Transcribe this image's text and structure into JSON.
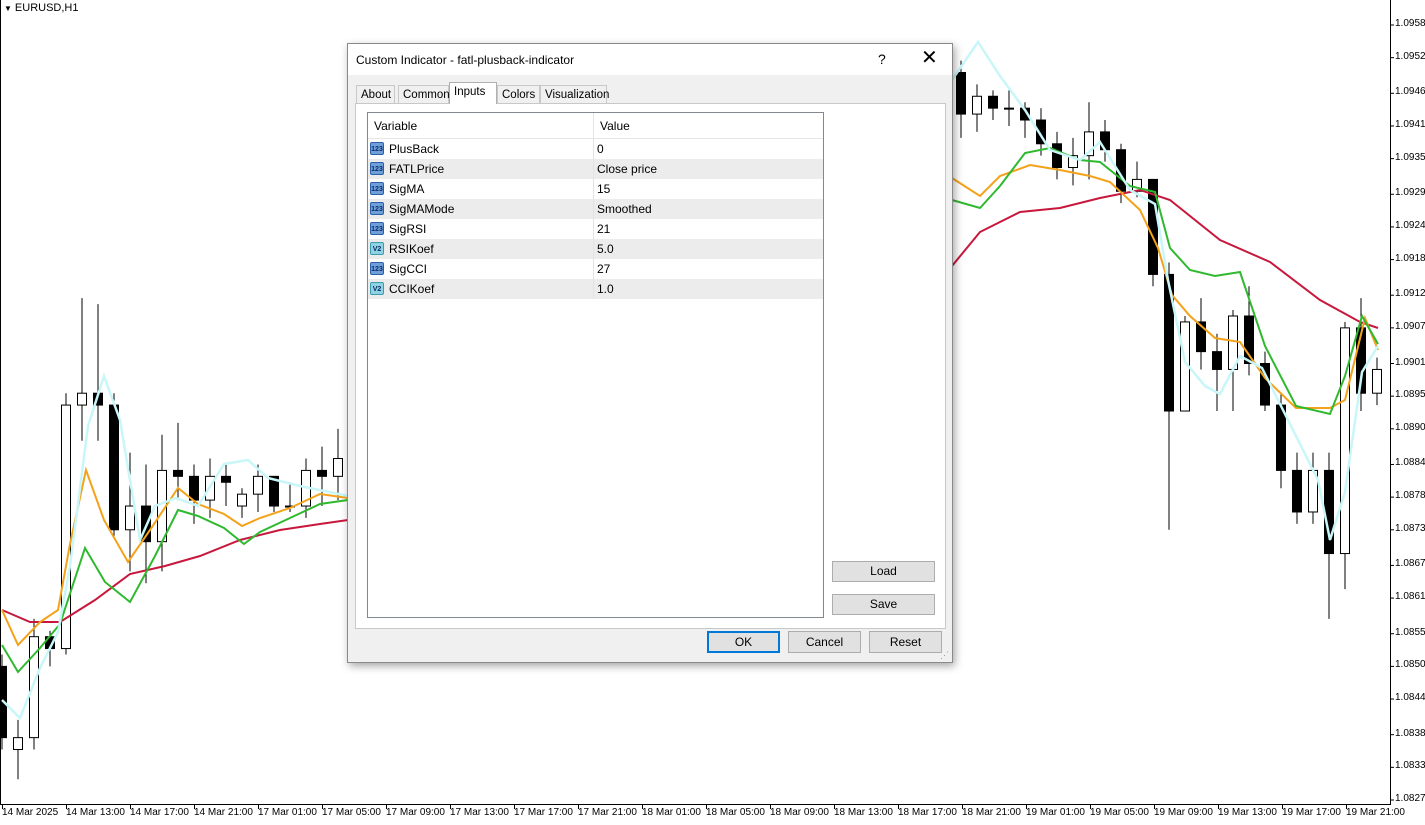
{
  "chart": {
    "symbol": "EURUSD,H1",
    "price_labels": [
      "1.09580",
      "1.09525",
      "1.09465",
      "1.09410",
      "1.09355",
      "1.09295",
      "1.09240",
      "1.09185",
      "1.09125",
      "1.09070",
      "1.09010",
      "1.08955",
      "1.08900",
      "1.08840",
      "1.08785",
      "1.08730",
      "1.08670",
      "1.08615",
      "1.08555",
      "1.08500",
      "1.08445",
      "1.08385",
      "1.08330",
      "1.08275"
    ],
    "time_labels": [
      "14 Mar 2025",
      "14 Mar 13:00",
      "14 Mar 17:00",
      "14 Mar 21:00",
      "17 Mar 01:00",
      "17 Mar 05:00",
      "17 Mar 09:00",
      "17 Mar 13:00",
      "17 Mar 17:00",
      "17 Mar 21:00",
      "18 Mar 01:00",
      "18 Mar 05:00",
      "18 Mar 09:00",
      "18 Mar 13:00",
      "18 Mar 17:00",
      "18 Mar 21:00",
      "19 Mar 01:00",
      "19 Mar 05:00",
      "19 Mar 09:00",
      "19 Mar 13:00",
      "19 Mar 17:00",
      "19 Mar 21:00"
    ],
    "colors": {
      "up_candle": "#ffffff",
      "down_candle": "#000000",
      "red_line": "#c8173c",
      "orange_line": "#f4a21a",
      "green_line": "#2fb92f",
      "cyan_line": "#c9f6f8"
    },
    "candles_left": [
      [
        1.085,
        1.0852,
        1.0836,
        1.0838
      ],
      [
        1.0836,
        1.0841,
        1.0831,
        1.0838
      ],
      [
        1.0838,
        1.0858,
        1.0836,
        1.0855
      ],
      [
        1.0855,
        1.0856,
        1.085,
        1.0853
      ],
      [
        1.0853,
        1.0896,
        1.0852,
        1.0894
      ],
      [
        1.0894,
        1.0912,
        1.0888,
        1.0896
      ],
      [
        1.0896,
        1.0911,
        1.0888,
        1.0894
      ],
      [
        1.0894,
        1.0896,
        1.0872,
        1.0873
      ],
      [
        1.0873,
        1.0886,
        1.0866,
        1.0877
      ],
      [
        1.0877,
        1.0884,
        1.0864,
        1.0871
      ],
      [
        1.0871,
        1.0889,
        1.0866,
        1.0883
      ],
      [
        1.0883,
        1.0891,
        1.0878,
        1.0882
      ],
      [
        1.0882,
        1.0884,
        1.0874,
        1.0878
      ],
      [
        1.0878,
        1.0885,
        1.0875,
        1.0882
      ],
      [
        1.0882,
        1.0884,
        1.0877,
        1.0881
      ],
      [
        1.0877,
        1.088,
        1.0875,
        1.0879
      ],
      [
        1.0879,
        1.0884,
        1.0876,
        1.0882
      ],
      [
        1.0882,
        1.0882,
        1.0876,
        1.0877
      ],
      [
        1.0877,
        1.0881,
        1.0876,
        1.0877
      ],
      [
        1.0877,
        1.0885,
        1.0875,
        1.0883
      ],
      [
        1.0883,
        1.0887,
        1.0877,
        1.0882
      ],
      [
        1.0882,
        1.089,
        1.0878,
        1.0885
      ]
    ],
    "candles_right": [
      [
        1.095,
        1.0952,
        1.0939,
        1.0943
      ],
      [
        1.0943,
        1.0948,
        1.094,
        1.0946
      ],
      [
        1.0946,
        1.0947,
        1.0942,
        1.0944
      ],
      [
        1.0944,
        1.0947,
        1.0941,
        1.0944
      ],
      [
        1.0944,
        1.0945,
        1.0939,
        1.0942
      ],
      [
        1.0942,
        1.0944,
        1.0936,
        1.0938
      ],
      [
        1.0938,
        1.094,
        1.0932,
        1.0934
      ],
      [
        1.0934,
        1.0939,
        1.0931,
        1.0936
      ],
      [
        1.0936,
        1.0945,
        1.0932,
        1.094
      ],
      [
        1.094,
        1.0942,
        1.0935,
        1.0937
      ],
      [
        1.0937,
        1.0938,
        1.0928,
        1.093
      ],
      [
        1.093,
        1.0935,
        1.0929,
        1.0932
      ],
      [
        1.0932,
        1.0932,
        1.0914,
        1.0916
      ],
      [
        1.0916,
        1.0918,
        1.0873,
        1.0893
      ],
      [
        1.0893,
        1.0909,
        1.0893,
        1.0908
      ],
      [
        1.0908,
        1.0912,
        1.09,
        1.0903
      ],
      [
        1.0903,
        1.0906,
        1.0893,
        1.09
      ],
      [
        1.09,
        1.091,
        1.0893,
        1.0909
      ],
      [
        1.0909,
        1.0914,
        1.0899,
        1.0901
      ],
      [
        1.0901,
        1.0903,
        1.0893,
        1.0894
      ],
      [
        1.0894,
        1.0896,
        1.088,
        1.0883
      ],
      [
        1.0883,
        1.0886,
        1.0874,
        1.0876
      ],
      [
        1.0876,
        1.0886,
        1.0874,
        1.0883
      ],
      [
        1.0883,
        1.0886,
        1.0858,
        1.0869
      ],
      [
        1.0869,
        1.0908,
        1.0863,
        1.0907
      ],
      [
        1.0907,
        1.0912,
        1.0893,
        1.0896
      ],
      [
        1.0896,
        1.0902,
        1.0894,
        1.09
      ]
    ]
  },
  "dialog": {
    "title": "Custom Indicator - fatl-plusback-indicator",
    "help": "?",
    "close": "✕",
    "tabs": [
      "About",
      "Common",
      "Inputs",
      "Colors",
      "Visualization"
    ],
    "active_tab": "Inputs",
    "columns": [
      "Variable",
      "Value"
    ],
    "rows": [
      {
        "icon": "123",
        "type": "int",
        "name": "PlusBack",
        "value": "0"
      },
      {
        "icon": "123",
        "type": "int",
        "name": "FATLPrice",
        "value": "Close price"
      },
      {
        "icon": "123",
        "type": "int",
        "name": "SigMA",
        "value": "15"
      },
      {
        "icon": "123",
        "type": "int",
        "name": "SigMAMode",
        "value": "Smoothed"
      },
      {
        "icon": "123",
        "type": "int",
        "name": "SigRSI",
        "value": "21"
      },
      {
        "icon": "V2",
        "type": "dbl",
        "name": "RSIKoef",
        "value": "5.0"
      },
      {
        "icon": "123",
        "type": "int",
        "name": "SigCCI",
        "value": "27"
      },
      {
        "icon": "V2",
        "type": "dbl",
        "name": "CCIKoef",
        "value": "1.0"
      }
    ],
    "load_label": "Load",
    "save_label": "Save",
    "ok_label": "OK",
    "cancel_label": "Cancel",
    "reset_label": "Reset"
  }
}
